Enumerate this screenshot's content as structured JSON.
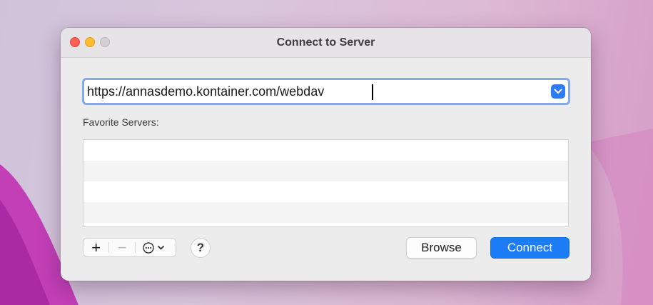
{
  "window": {
    "title": "Connect to Server"
  },
  "server_address": {
    "value": "https://annasdemo.kontainer.com/webdav"
  },
  "favorites": {
    "label": "Favorite Servers:",
    "items": []
  },
  "toolbar": {
    "add_label": "+",
    "remove_label": "−",
    "help_label": "?"
  },
  "buttons": {
    "browse": "Browse",
    "connect": "Connect"
  },
  "colors": {
    "accent": "#1b7cf5",
    "close": "#fe5f57",
    "minimize": "#febc2e",
    "zoom_inactive": "#d1cfd1"
  }
}
